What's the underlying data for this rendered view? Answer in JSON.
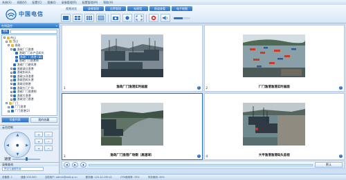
{
  "window": {
    "menu": [
      "系统(S)",
      "视图(V)",
      "配置(C)",
      "图像(I)",
      "录像管理(R)",
      "配置管理(M)",
      "帮助(H)"
    ]
  },
  "header": {
    "brand": "中国电信"
  },
  "tabs": [
    {
      "label": "视频浏览",
      "active": true
    },
    {
      "label": "录像管理",
      "active": false
    },
    {
      "label": "告警管理",
      "active": false
    },
    {
      "label": "电视墙",
      "active": false
    },
    {
      "label": "报道查看",
      "active": false
    },
    {
      "label": "电子地图",
      "active": false
    }
  ],
  "toolbar": {
    "icons": [
      "layout-1-icon",
      "layout-4-icon",
      "layout-9-icon",
      "layout-16-icon",
      "snapshot-icon",
      "record-icon",
      "fullscreen-icon",
      "stop-icon",
      "volume-icon"
    ]
  },
  "sidebar": {
    "title": "在线监控",
    "search_label": "搜索",
    "tree": [
      {
        "label": "舟山",
        "depth": 0,
        "type": "folder",
        "toggle": "-"
      },
      {
        "label": "岱山",
        "depth": 1,
        "type": "folder",
        "toggle": "-"
      },
      {
        "label": "渔政",
        "depth": 2,
        "type": "folder",
        "toggle": "-"
      },
      {
        "label": "渔政厂门渔港",
        "depth": 3,
        "type": "cam",
        "toggle": "-"
      },
      {
        "label": "渔政厂门水产品码头",
        "depth": 4,
        "type": "cam",
        "toggle": ""
      },
      {
        "label": "渔政厂门渔港 (高)",
        "depth": 4,
        "type": "cam",
        "toggle": "",
        "selected": true
      },
      {
        "label": "渔政厂门渔港侧",
        "depth": 4,
        "type": "cam",
        "toggle": ""
      },
      {
        "label": "渔政厂门避风港",
        "depth": 3,
        "type": "cam",
        "toggle": ""
      },
      {
        "label": "渔政溪口渔港",
        "depth": 3,
        "type": "cam",
        "toggle": "+"
      },
      {
        "label": "渔政东码头",
        "depth": 3,
        "type": "cam",
        "toggle": "+"
      },
      {
        "label": "渔政沙洋渔港",
        "depth": 3,
        "type": "cam",
        "toggle": "+"
      },
      {
        "label": "渔政西码头港",
        "depth": 3,
        "type": "cam",
        "toggle": "+"
      },
      {
        "label": "渔政北侧港",
        "depth": 3,
        "type": "cam",
        "toggle": "+"
      },
      {
        "label": "渔政大门广场",
        "depth": 3,
        "type": "cam",
        "toggle": "+"
      },
      {
        "label": "渔政厂门渔港侧",
        "depth": 3,
        "type": "cam",
        "toggle": "+"
      },
      {
        "label": "渔政大渔港",
        "depth": 3,
        "type": "cam",
        "toggle": "+"
      },
      {
        "label": "渔政沈门渔港",
        "depth": 3,
        "type": "cam",
        "toggle": "+"
      },
      {
        "label": "厂门",
        "depth": 1,
        "type": "folder",
        "toggle": "-"
      },
      {
        "label": "厂门渔港",
        "depth": 2,
        "type": "cam",
        "toggle": "+"
      },
      {
        "label": "厂门渔港(2)",
        "depth": 2,
        "type": "cam",
        "toggle": "+"
      }
    ],
    "tabs": [
      {
        "label": "设备列表",
        "active": true
      },
      {
        "label": "我的收藏",
        "active": false
      }
    ],
    "ptz_title": "云台控制",
    "ptz_buttons": [
      "+",
      "−",
      "+",
      "−",
      "+",
      "−"
    ],
    "speed_label": "速度",
    "record_title": "录像查询",
    "record_button": "预设与编辑布局"
  },
  "cameras": [
    {
      "index": "1",
      "caption": "渔政厂门渔港实时画面",
      "scene": "harbor-dusk"
    },
    {
      "index": "2",
      "caption": "厂门渔港渔港实时画面",
      "scene": "harbor-bay"
    },
    {
      "index": "3",
      "caption": "渔政厂门渔港广场侧（高速球）",
      "scene": "river"
    },
    {
      "index": "4",
      "caption": "大平渔港渔港码头监视",
      "scene": "pier"
    }
  ],
  "controls": {
    "default_button": "默认"
  },
  "status": {
    "items": [
      "设备数: 1",
      "速度 200.000",
      "当前用户: admin@dxtt.zj.cn",
      "服务器: 125.10.199.41",
      "CPU使用率: 33%",
      "内存使用: 49%"
    ]
  },
  "colors": {
    "accent": "#2a6fc2",
    "panel": "#cfe0f2"
  }
}
